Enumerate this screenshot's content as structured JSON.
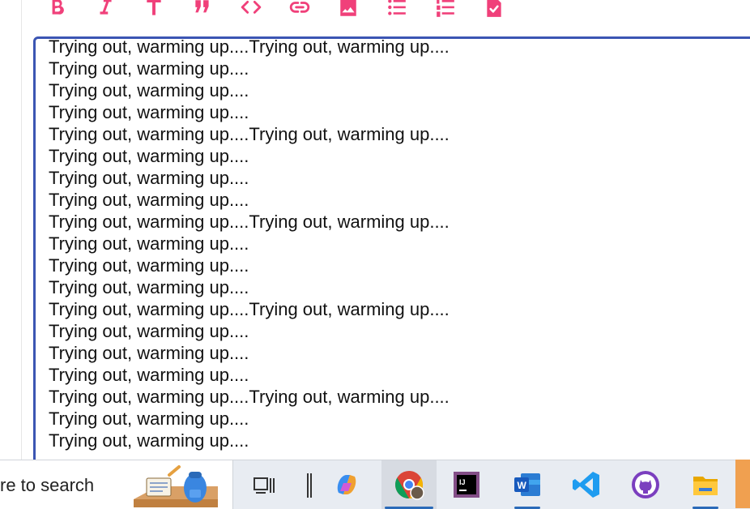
{
  "editor": {
    "lines": [
      "Trying out, warming up....Trying out, warming up....",
      "Trying out, warming up....",
      "Trying out, warming up....",
      "Trying out, warming up....",
      "Trying out, warming up....Trying out, warming up....",
      "Trying out, warming up....",
      "Trying out, warming up....",
      "Trying out, warming up....",
      "Trying out, warming up....Trying out, warming up....",
      "Trying out, warming up....",
      "Trying out, warming up....",
      "Trying out, warming up....",
      "Trying out, warming up....Trying out, warming up....",
      "Trying out, warming up....",
      "Trying out, warming up....",
      "Trying out, warming up....",
      "Trying out, warming up....Trying out, warming up....",
      "Trying out, warming up....",
      "Trying out, warming up...."
    ]
  },
  "toolbar": {
    "icon_color": "#f0407a",
    "buttons": [
      "bold-icon",
      "italic-icon",
      "heading-icon",
      "quote-icon",
      "code-icon",
      "link-icon",
      "image-icon",
      "bullet-list-icon",
      "numbered-list-icon",
      "task-list-icon"
    ]
  },
  "taskbar": {
    "search_placeholder": "re to search",
    "apps": [
      "task-view-icon",
      "widgets-divider-icon",
      "copilot-icon",
      "chrome-icon",
      "intellij-icon",
      "word-icon",
      "vscode-icon",
      "github-desktop-icon",
      "file-explorer-icon"
    ]
  }
}
